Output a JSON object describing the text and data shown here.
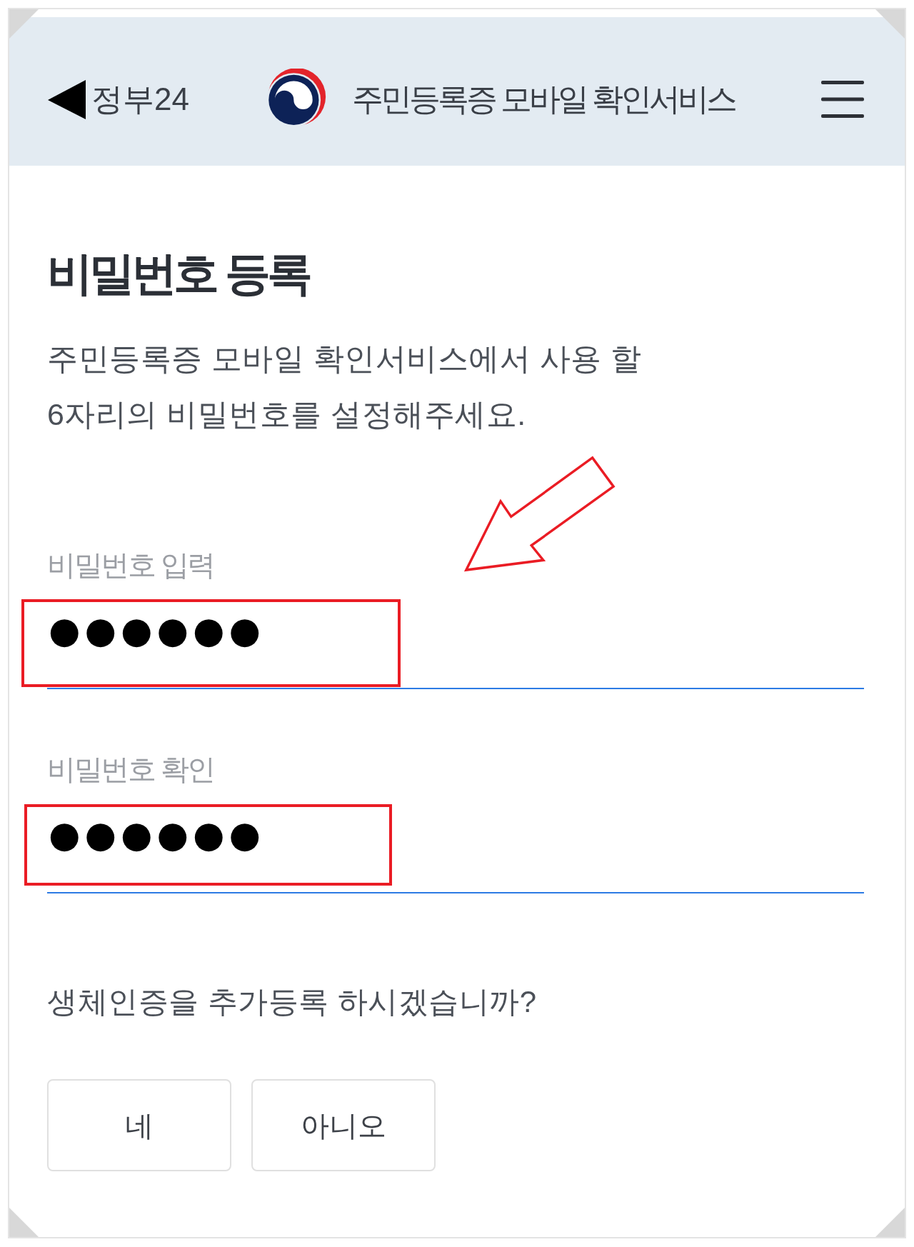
{
  "header": {
    "back_label": "정부24",
    "title": "주민등록증 모바일 확인서비스"
  },
  "page": {
    "heading": "비밀번호 등록",
    "description": [
      "주민등록증 모바일 확인서비스에서 사용 할",
      "6자리의 비밀번호를 설정해주세요."
    ]
  },
  "fields": [
    {
      "label": "비밀번호 입력",
      "value": "●●●●●●",
      "highlighted": true,
      "pointed_at": true
    },
    {
      "label": "비밀번호 확인",
      "value": "●●●●●●",
      "highlighted": true,
      "pointed_at": false
    }
  ],
  "biometric": {
    "question": "생체인증을 추가등록 하시겠습니까?",
    "buttons": [
      "네",
      "아니오"
    ]
  }
}
